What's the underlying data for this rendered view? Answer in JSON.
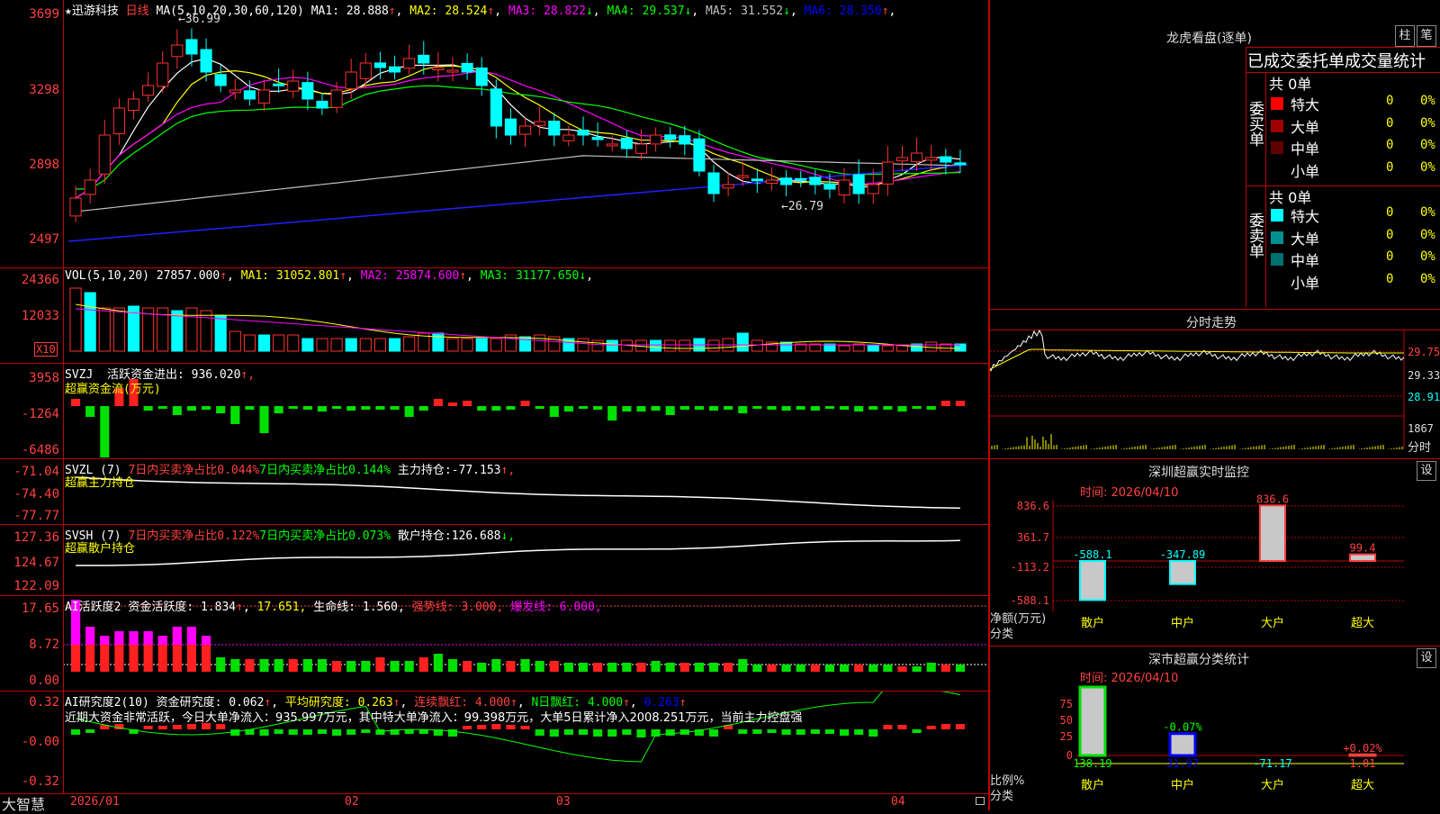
{
  "app": {
    "brand": "大智慧"
  },
  "kline": {
    "title": "迅游科技",
    "period": "日线",
    "ma_label": "MA(5,10,20,30,60,120)",
    "ma": [
      {
        "name": "MA1:",
        "value": "28.888",
        "arrow": "↑",
        "color": "#ffffff"
      },
      {
        "name": "MA2:",
        "value": "28.524",
        "arrow": "↑",
        "color": "#ffff00"
      },
      {
        "name": "MA3:",
        "value": "28.822",
        "arrow": "↓",
        "color": "#ff00ff"
      },
      {
        "name": "MA4:",
        "value": "29.537",
        "arrow": "↓",
        "color": "#00ff00"
      },
      {
        "name": "MA5:",
        "value": "31.552",
        "arrow": "↓",
        "color": "#c0c0c0"
      },
      {
        "name": "MA6:",
        "value": "28.350",
        "arrow": "↑",
        "color": "#0000ff"
      }
    ],
    "high_mark": "36.99",
    "low_mark": "26.79",
    "yaxis": [
      "3699",
      "3298",
      "2898",
      "2497"
    ]
  },
  "vol": {
    "label": "VOL(5,10,20)",
    "value": "27857.000",
    "value_arrow": "↑",
    "ma": [
      {
        "name": "MA1:",
        "value": "31052.801",
        "arrow": "↑",
        "color": "#ffff00"
      },
      {
        "name": "MA2:",
        "value": "25874.600",
        "arrow": "↑",
        "color": "#ff00ff"
      },
      {
        "name": "MA3:",
        "value": "31177.650",
        "arrow": "↓",
        "color": "#00ff00"
      }
    ],
    "yaxis": [
      "24366",
      "12033"
    ],
    "unit": "X10"
  },
  "svzj": {
    "label": "SVZJ",
    "text1": "活跃资金进出:",
    "value": "936.020",
    "arrow": "↑,",
    "sub": "超赢资金流(万元)",
    "yaxis": [
      "3958",
      "-1264",
      "-6486"
    ]
  },
  "svzl": {
    "label": "SVZL (7)",
    "a": "7日内买卖净占比0.044%",
    "b": "7日内买卖净占比0.144%",
    "c": "主力持仓:",
    "value": "-77.153",
    "arrow": "↑,",
    "sub": "超赢主力持仓",
    "yaxis": [
      "-71.04",
      "-74.40",
      "-77.77"
    ]
  },
  "svsh": {
    "label": "SVSH (7)",
    "a": "7日内买卖净占比0.122%",
    "b": "7日内买卖净占比0.073%",
    "c": "散户持仓:",
    "value": "126.688",
    "arrow": "↓,",
    "sub": "超赢散户持仓",
    "yaxis": [
      "127.36",
      "124.67",
      "122.09"
    ]
  },
  "ai2": {
    "label": "AI活跃度2",
    "t1": "资金活跃度:",
    "v1": "1.834",
    "v2": "17.651,",
    "t3": "生命线:",
    "v3": "1.560,",
    "t4": "强势线:",
    "v4": "3.000,",
    "t5": "爆发线:",
    "v5": "6.000,",
    "yaxis": [
      "17.65",
      "8.72",
      "0.00"
    ]
  },
  "ai_research": {
    "label": "AI研究度2(10)",
    "t1": "资金研究度:",
    "v1": "0.062",
    "t2": "平均研究度:",
    "v2": "0.263",
    "t3": "连续飘红:",
    "v3": "4.000",
    "t4": "N日飘红:",
    "v4": "4.000",
    "v5": "0.263",
    "comment": "近期大资金非常活跃，今日大单净流入：935.997万元，其中特大单净流入：99.398万元，大单5日累计净入2008.251万元，当前主力控盘强",
    "yaxis": [
      "0.32",
      "-0.00",
      "-0.32"
    ]
  },
  "dates": [
    "2026/01",
    "02",
    "03",
    "04"
  ],
  "longhu": {
    "title": "龙虎看盘(逐单)",
    "btn1": "柱",
    "btn2": "笔",
    "subtitle": "已成交委托单成交量统计",
    "buy": {
      "side_label": "委买单",
      "total": "共 0单",
      "rows": [
        {
          "label": "特大",
          "vol": "0",
          "pct": "0%",
          "color": "#ff0000"
        },
        {
          "label": "大单",
          "vol": "0",
          "pct": "0%",
          "color": "#a00000"
        },
        {
          "label": "中单",
          "vol": "0",
          "pct": "0%",
          "color": "#600000"
        },
        {
          "label": "小单",
          "vol": "0",
          "pct": "0%",
          "color": "#000000"
        }
      ]
    },
    "sell": {
      "side_label": "委卖单",
      "total": "共 0单",
      "rows": [
        {
          "label": "特大",
          "vol": "0",
          "pct": "0%",
          "color": "#00ffff"
        },
        {
          "label": "大单",
          "vol": "0",
          "pct": "0%",
          "color": "#009090"
        },
        {
          "label": "中单",
          "vol": "0",
          "pct": "0%",
          "color": "#007070"
        },
        {
          "label": "小单",
          "vol": "0",
          "pct": "0%",
          "color": "#000000"
        }
      ]
    }
  },
  "intraday": {
    "title": "分时走势",
    "yaxis": [
      "29.75",
      "29.33",
      "28.91"
    ],
    "vol_label": "1867",
    "vol_sub": "分时"
  },
  "sz_monitor": {
    "title": "深圳超赢实时监控",
    "btn": "设",
    "time": "时间: 2026/04/10",
    "yaxis": [
      "836.6",
      "361.7",
      "-113.2",
      "-588.1"
    ],
    "ylabel": "净额(万元)",
    "xlabel": "分类",
    "categories": [
      "散户",
      "中户",
      "大户",
      "超大"
    ],
    "values": [
      "-588.1",
      "-347.89",
      "836.6",
      "99.4"
    ]
  },
  "sz_class": {
    "title": "深市超赢分类统计",
    "btn": "设",
    "time": "时间: 2026/04/10",
    "yaxis": [
      "75",
      "50",
      "25",
      "0"
    ],
    "ylabel": "比例%",
    "xlabel": "分类",
    "categories": [
      "散户",
      "中户",
      "大户",
      "超大"
    ],
    "values": [
      "138.19",
      "31.97",
      "-71.17",
      "1.01"
    ],
    "bar_labels": [
      "",
      "-0.07%",
      "",
      "+0.02%"
    ]
  }
}
